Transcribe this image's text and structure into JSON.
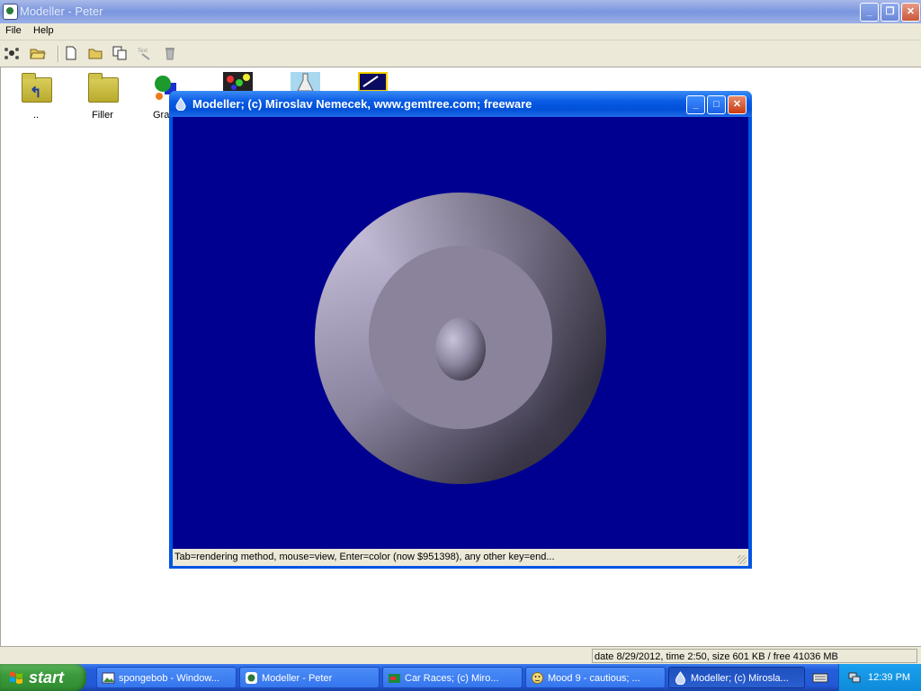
{
  "main_window": {
    "title": "Modeller - Peter",
    "title_buttons": [
      "minimize",
      "restore",
      "close"
    ]
  },
  "menu": {
    "file": "File",
    "help": "Help"
  },
  "toolbar": {
    "icons": [
      "network-icon",
      "open-folder-icon",
      "new-file-icon",
      "new-folder-icon",
      "copy-icon",
      "text-tool-icon",
      "delete-icon"
    ]
  },
  "files": [
    {
      "label": "..",
      "icon": "up-folder-icon"
    },
    {
      "label": "Filler",
      "icon": "folder-icon"
    },
    {
      "label": "Gra",
      "icon": "graphics-icon"
    }
  ],
  "dialog": {
    "title": "Modeller;   (c) Miroslav Nemecek, www.gemtree.com;   freeware",
    "status": "Tab=rendering method,   mouse=view,   Enter=color (now $951398),   any other key=end...",
    "canvas_bg": "#000090",
    "model_color": "#b0a7c8"
  },
  "status_bar": {
    "info": "date 8/29/2012, time 2:50, size 601 KB / free 41036 MB"
  },
  "taskbar": {
    "start_label": "start",
    "tasks": [
      {
        "label": "spongebob - Window...",
        "icon": "image-icon"
      },
      {
        "label": "Modeller - Peter",
        "icon": "peter-icon"
      },
      {
        "label": "Car Races;  (c) Miro...",
        "icon": "car-icon"
      },
      {
        "label": "Mood 9 - cautious;  ...",
        "icon": "smiley-icon"
      },
      {
        "label": "Modeller;  (c) Mirosla...",
        "icon": "drop-icon"
      }
    ],
    "clock": "12:39 PM"
  }
}
